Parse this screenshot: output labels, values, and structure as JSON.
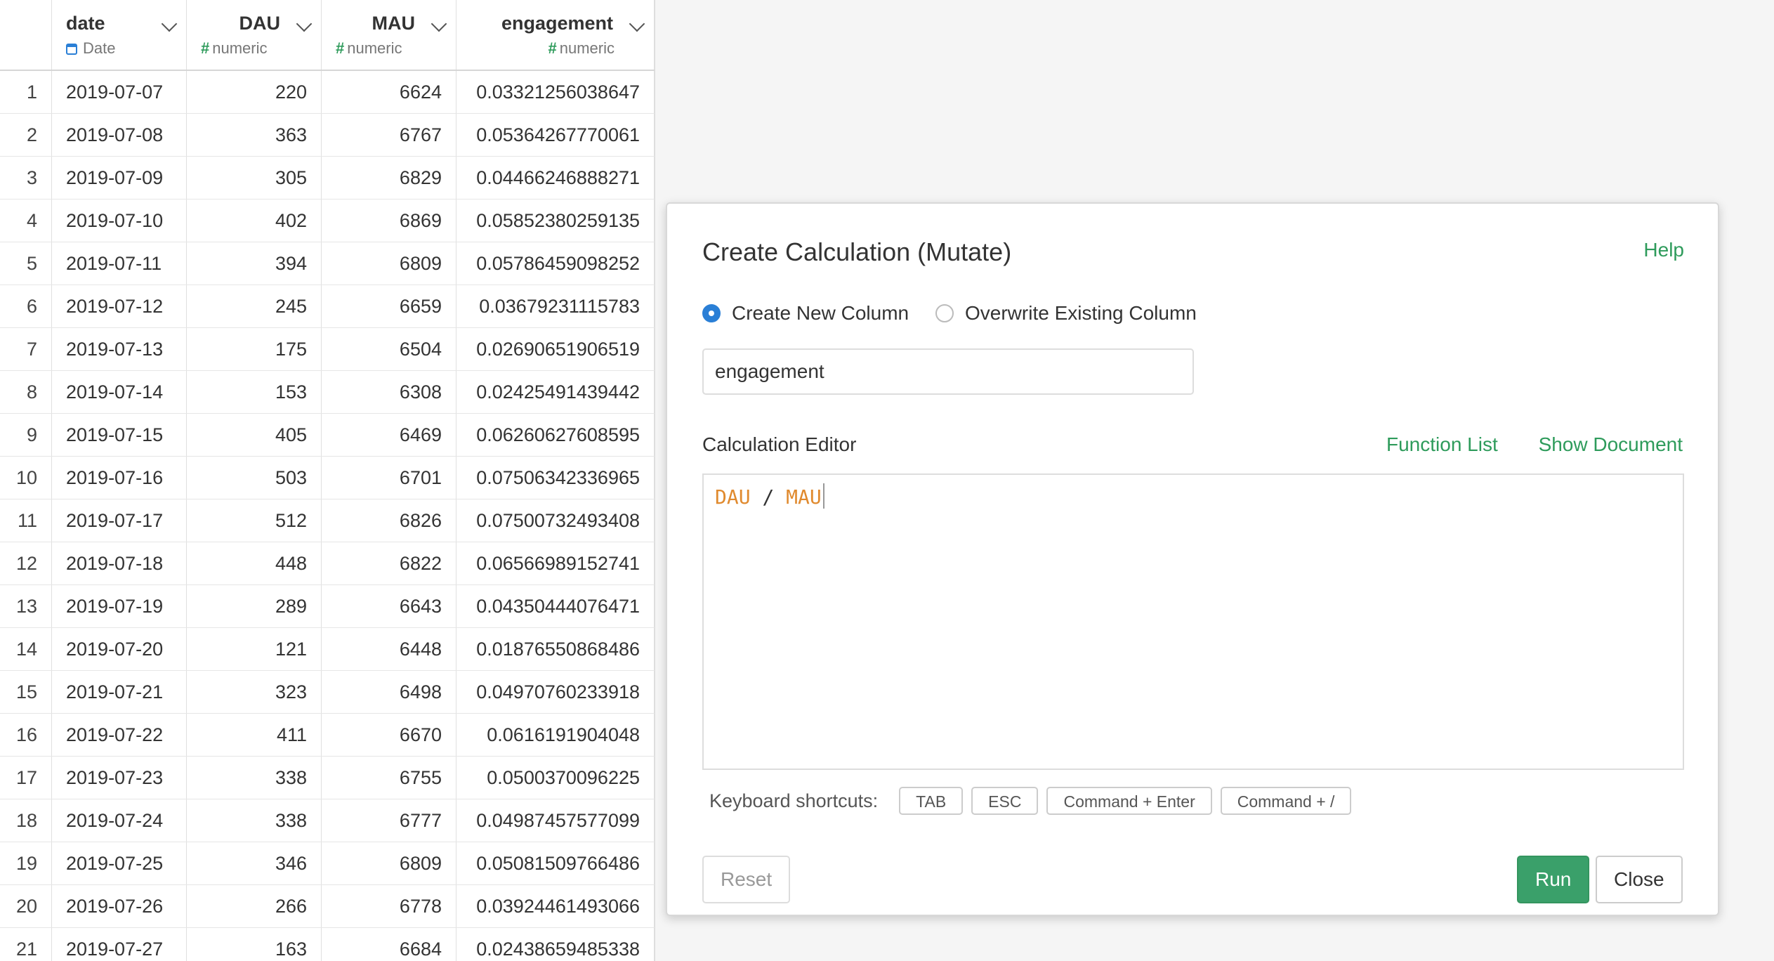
{
  "grid": {
    "columns": [
      {
        "name": "date",
        "type": "Date"
      },
      {
        "name": "DAU",
        "type": "numeric"
      },
      {
        "name": "MAU",
        "type": "numeric"
      },
      {
        "name": "engagement",
        "type": "numeric"
      }
    ],
    "rows": [
      [
        "1",
        "2019-07-07",
        "220",
        "6624",
        "0.03321256038647"
      ],
      [
        "2",
        "2019-07-08",
        "363",
        "6767",
        "0.05364267770061"
      ],
      [
        "3",
        "2019-07-09",
        "305",
        "6829",
        "0.04466246888271"
      ],
      [
        "4",
        "2019-07-10",
        "402",
        "6869",
        "0.05852380259135"
      ],
      [
        "5",
        "2019-07-11",
        "394",
        "6809",
        "0.05786459098252"
      ],
      [
        "6",
        "2019-07-12",
        "245",
        "6659",
        "0.03679231115783"
      ],
      [
        "7",
        "2019-07-13",
        "175",
        "6504",
        "0.02690651906519"
      ],
      [
        "8",
        "2019-07-14",
        "153",
        "6308",
        "0.02425491439442"
      ],
      [
        "9",
        "2019-07-15",
        "405",
        "6469",
        "0.06260627608595"
      ],
      [
        "10",
        "2019-07-16",
        "503",
        "6701",
        "0.07506342336965"
      ],
      [
        "11",
        "2019-07-17",
        "512",
        "6826",
        "0.07500732493408"
      ],
      [
        "12",
        "2019-07-18",
        "448",
        "6822",
        "0.06566989152741"
      ],
      [
        "13",
        "2019-07-19",
        "289",
        "6643",
        "0.04350444076471"
      ],
      [
        "14",
        "2019-07-20",
        "121",
        "6448",
        "0.01876550868486"
      ],
      [
        "15",
        "2019-07-21",
        "323",
        "6498",
        "0.04970760233918"
      ],
      [
        "16",
        "2019-07-22",
        "411",
        "6670",
        "0.0616191904048"
      ],
      [
        "17",
        "2019-07-23",
        "338",
        "6755",
        "0.0500370096225"
      ],
      [
        "18",
        "2019-07-24",
        "338",
        "6777",
        "0.04987457577099"
      ],
      [
        "19",
        "2019-07-25",
        "346",
        "6809",
        "0.05081509766486"
      ],
      [
        "20",
        "2019-07-26",
        "266",
        "6778",
        "0.03924461493066"
      ],
      [
        "21",
        "2019-07-27",
        "163",
        "6684",
        "0.02438659485338"
      ]
    ]
  },
  "dialog": {
    "title": "Create Calculation (Mutate)",
    "help_label": "Help",
    "radio_new": "Create New Column",
    "radio_overwrite": "Overwrite Existing Column",
    "selected_mode": "Create New Column",
    "column_name": "engagement",
    "editor_label": "Calculation Editor",
    "function_list_label": "Function List",
    "show_document_label": "Show Document",
    "expression": {
      "left": "DAU",
      "op": "/",
      "right": "MAU"
    },
    "shortcuts_label": "Keyboard shortcuts:",
    "shortcuts": [
      "TAB",
      "ESC",
      "Command + Enter",
      "Command + /"
    ],
    "reset_label": "Reset",
    "run_label": "Run",
    "close_label": "Close"
  },
  "colors": {
    "accent_green": "#3aa06a",
    "link_green": "#2e9b5b",
    "radio_blue": "#2a7fd6",
    "code_orange": "#e08a2e"
  }
}
